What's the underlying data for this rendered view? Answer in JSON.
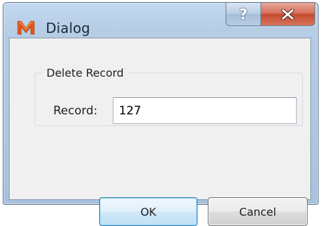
{
  "window": {
    "title": "Dialog",
    "app_icon": "m-logo-icon",
    "help_label": "?",
    "close_icon": "close-icon"
  },
  "group": {
    "title": "Delete Record"
  },
  "record": {
    "label": "Record:",
    "value": "127"
  },
  "buttons": {
    "ok_label": "OK",
    "cancel_label": "Cancel"
  },
  "colors": {
    "accent": "#3c7fb1",
    "close": "#c44a30"
  }
}
